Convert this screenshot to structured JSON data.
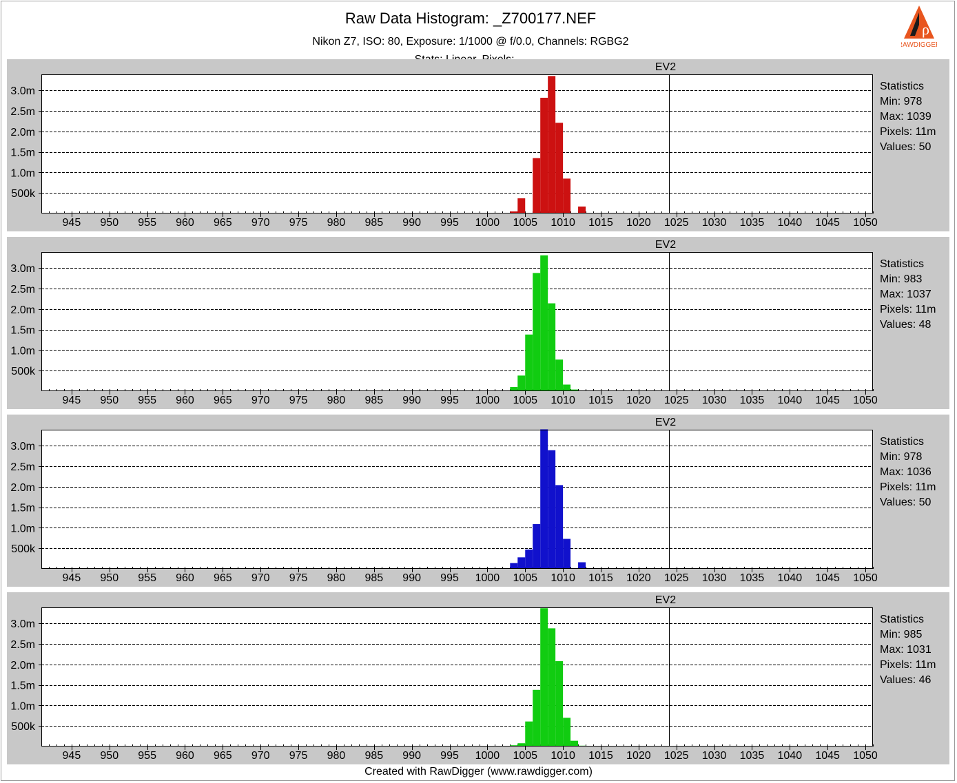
{
  "header": {
    "title": "Raw Data Histogram: _Z700177.NEF",
    "subtitle": "Nikon Z7, ISO: 80, Exposure: 1/1000 @ f/0.0, Channels: RGBG2",
    "subtitle2": "Stats: Linear, Pixels: ...",
    "logo_text": "RAWDIGGER"
  },
  "footer": {
    "text": "Created with RawDigger (www.rawdigger.com)"
  },
  "colors": {
    "red": "#cc1111",
    "green": "#11cc11",
    "blue": "#1111cc",
    "panel_bg": "#c8c8c8"
  },
  "chart_data": [
    {
      "type": "bar",
      "title": "EV2",
      "channel": "R",
      "color": "#cc1111",
      "xlim": [
        941,
        1051
      ],
      "ylim": [
        0,
        3390000
      ],
      "xticks": [
        945,
        950,
        955,
        960,
        965,
        970,
        975,
        980,
        985,
        990,
        995,
        1000,
        1005,
        1010,
        1015,
        1020,
        1025,
        1030,
        1035,
        1040,
        1045,
        1050
      ],
      "yticks": [
        500000,
        1000000,
        1500000,
        2000000,
        2500000,
        3000000
      ],
      "ytick_labels": [
        "500k",
        "1.0m",
        "1.5m",
        "2.0m",
        "2.5m",
        "3.0m"
      ],
      "vline": 1024,
      "x": [
        1002,
        1003,
        1004,
        1005,
        1006,
        1007,
        1008,
        1009,
        1010,
        1011,
        1012,
        1013
      ],
      "values": [
        8000,
        50000,
        370000,
        10000,
        1350000,
        2820000,
        3350000,
        2210000,
        850000,
        10000,
        170000,
        15000
      ],
      "statistics": {
        "heading": "Statistics",
        "min": "Min: 978",
        "max": "Max: 1039",
        "pixels": "Pixels: 11m",
        "values": "Values: 50"
      }
    },
    {
      "type": "bar",
      "title": "EV2",
      "channel": "G",
      "color": "#11cc11",
      "xlim": [
        941,
        1051
      ],
      "ylim": [
        0,
        3390000
      ],
      "xticks": [
        945,
        950,
        955,
        960,
        965,
        970,
        975,
        980,
        985,
        990,
        995,
        1000,
        1005,
        1010,
        1015,
        1020,
        1025,
        1030,
        1035,
        1040,
        1045,
        1050
      ],
      "yticks": [
        500000,
        1000000,
        1500000,
        2000000,
        2500000,
        3000000
      ],
      "ytick_labels": [
        "500k",
        "1.0m",
        "1.5m",
        "2.0m",
        "2.5m",
        "3.0m"
      ],
      "vline": 1024,
      "x": [
        1002,
        1003,
        1004,
        1005,
        1006,
        1007,
        1008,
        1009,
        1010,
        1011,
        1012,
        1013
      ],
      "values": [
        8000,
        100000,
        380000,
        1380000,
        2880000,
        3310000,
        2140000,
        770000,
        160000,
        40000,
        8000,
        4000
      ],
      "statistics": {
        "heading": "Statistics",
        "min": "Min: 983",
        "max": "Max: 1037",
        "pixels": "Pixels: 11m",
        "values": "Values: 48"
      }
    },
    {
      "type": "bar",
      "title": "EV2",
      "channel": "B",
      "color": "#1111cc",
      "xlim": [
        941,
        1051
      ],
      "ylim": [
        0,
        3390000
      ],
      "xticks": [
        945,
        950,
        955,
        960,
        965,
        970,
        975,
        980,
        985,
        990,
        995,
        1000,
        1005,
        1010,
        1015,
        1020,
        1025,
        1030,
        1035,
        1040,
        1045,
        1050
      ],
      "yticks": [
        500000,
        1000000,
        1500000,
        2000000,
        2500000,
        3000000
      ],
      "ytick_labels": [
        "500k",
        "1.0m",
        "1.5m",
        "2.0m",
        "2.5m",
        "3.0m"
      ],
      "vline": 1024,
      "x": [
        1002,
        1003,
        1004,
        1005,
        1006,
        1007,
        1008,
        1009,
        1010,
        1011,
        1012,
        1013
      ],
      "values": [
        8000,
        140000,
        280000,
        470000,
        1090000,
        3400000,
        2890000,
        2040000,
        730000,
        15000,
        160000,
        15000
      ],
      "statistics": {
        "heading": "Statistics",
        "min": "Min: 978",
        "max": "Max: 1036",
        "pixels": "Pixels: 11m",
        "values": "Values: 50"
      }
    },
    {
      "type": "bar",
      "title": "EV2",
      "channel": "G2",
      "color": "#11cc11",
      "xlim": [
        941,
        1051
      ],
      "ylim": [
        0,
        3390000
      ],
      "xticks": [
        945,
        950,
        955,
        960,
        965,
        970,
        975,
        980,
        985,
        990,
        995,
        1000,
        1005,
        1010,
        1015,
        1020,
        1025,
        1030,
        1035,
        1040,
        1045,
        1050
      ],
      "yticks": [
        500000,
        1000000,
        1500000,
        2000000,
        2500000,
        3000000
      ],
      "ytick_labels": [
        "500k",
        "1.0m",
        "1.5m",
        "2.0m",
        "2.5m",
        "3.0m"
      ],
      "vline": 1024,
      "x": [
        1002,
        1003,
        1004,
        1005,
        1006,
        1007,
        1008,
        1009,
        1010,
        1011,
        1012,
        1013
      ],
      "values": [
        8000,
        30000,
        80000,
        610000,
        1380000,
        3370000,
        2880000,
        2080000,
        700000,
        140000,
        20000,
        6000
      ],
      "statistics": {
        "heading": "Statistics",
        "min": "Min: 985",
        "max": "Max: 1031",
        "pixels": "Pixels: 11m",
        "values": "Values: 46"
      }
    }
  ]
}
